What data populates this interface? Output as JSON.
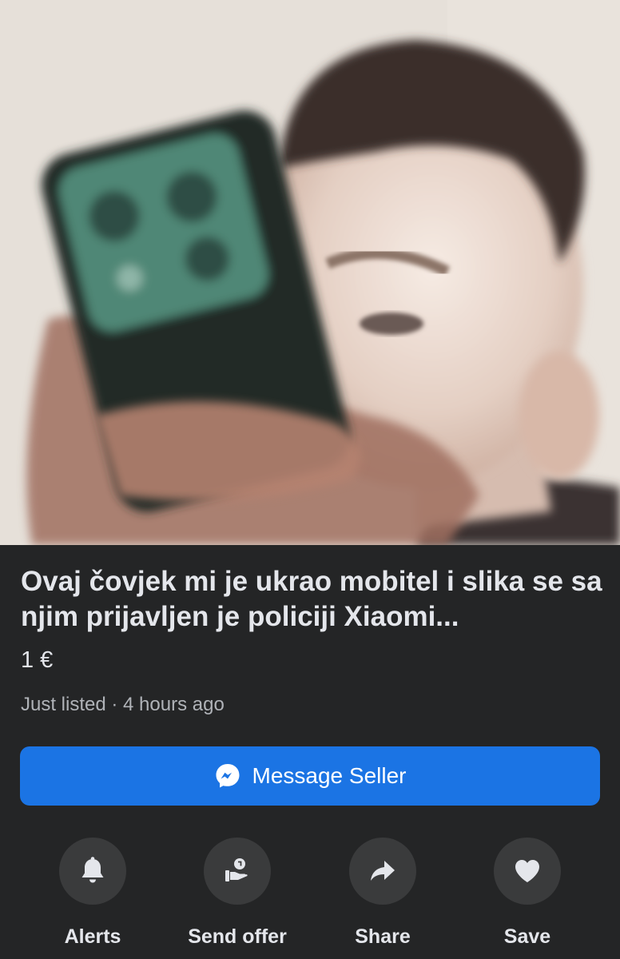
{
  "listing": {
    "title": "Ovaj čovjek mi je ukrao mobitel i slika se sa njim prijavljen je policiji Xiaomi...",
    "price": "1 €",
    "meta": "Just listed · 4 hours ago"
  },
  "message_button": {
    "label": "Message Seller",
    "icon": "messenger-icon"
  },
  "actions": [
    {
      "label": "Alerts",
      "icon": "bell-icon"
    },
    {
      "label": "Send offer",
      "icon": "send-offer-icon"
    },
    {
      "label": "Share",
      "icon": "share-arrow-icon"
    },
    {
      "label": "Save",
      "icon": "heart-icon"
    }
  ],
  "colors": {
    "background": "#242526",
    "accent": "#1b74e4",
    "text_primary": "#e4e6eb",
    "text_secondary": "#b0b3b8",
    "icon_circle": "#3a3b3c"
  }
}
